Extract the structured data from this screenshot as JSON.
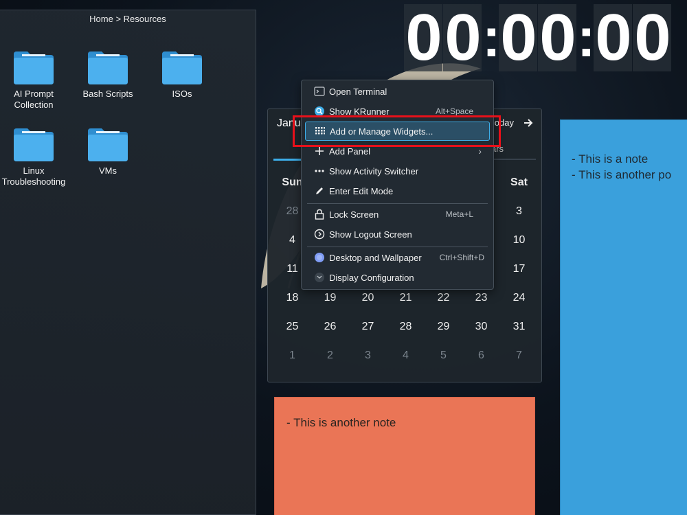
{
  "folder_view": {
    "breadcrumb": "Home > Resources",
    "items": [
      {
        "label_1": "AI Prompt",
        "label_2": "Collection"
      },
      {
        "label_1": "Bash Scripts",
        "label_2": ""
      },
      {
        "label_1": "ISOs",
        "label_2": ""
      },
      {
        "label_1": "Linux",
        "label_2": "Troubleshooting"
      },
      {
        "label_1": "VMs",
        "label_2": ""
      }
    ]
  },
  "clock": {
    "digits": [
      "0",
      "0",
      "0",
      "0",
      "0",
      "0"
    ],
    "separator": ":"
  },
  "calendar": {
    "month_partial": "Janua",
    "today_label": "oday",
    "next_icon": "arrow-right-icon",
    "tab_label_partial": "ars",
    "weekdays": [
      "Sun",
      "",
      "",
      "",
      "",
      "",
      "Sat"
    ],
    "weeks": [
      [
        "28",
        "",
        "",
        "",
        "",
        "",
        "3"
      ],
      [
        "4",
        "",
        "",
        "",
        "",
        "",
        "10"
      ],
      [
        "11",
        "",
        "",
        "",
        "",
        "",
        "17"
      ],
      [
        "18",
        "19",
        "20",
        "21",
        "22",
        "23",
        "24"
      ],
      [
        "25",
        "26",
        "27",
        "28",
        "29",
        "30",
        "31"
      ],
      [
        "1",
        "2",
        "3",
        "4",
        "5",
        "6",
        "7"
      ]
    ]
  },
  "notes": {
    "blue": [
      "- This is a note",
      "- This is another po"
    ],
    "orange": "- This is another note"
  },
  "context_menu": {
    "items": [
      {
        "label": "Open Terminal",
        "shortcut": "",
        "icon": "terminal-icon"
      },
      {
        "label": "Show KRunner",
        "shortcut": "Alt+Space",
        "icon": "search-icon"
      },
      {
        "label": "Add or Manage Widgets...",
        "shortcut": "",
        "icon": "grid-icon"
      },
      {
        "label": "Add Panel",
        "shortcut": "",
        "icon": "plus-icon"
      },
      {
        "label": "Show Activity Switcher",
        "shortcut": "",
        "icon": "dots-icon"
      },
      {
        "label": "Enter Edit Mode",
        "shortcut": "",
        "icon": "pencil-icon"
      },
      {
        "label": "Lock Screen",
        "shortcut": "Meta+L",
        "icon": "lock-icon"
      },
      {
        "label": "Show Logout Screen",
        "shortcut": "",
        "icon": "logout-icon"
      },
      {
        "label": "Desktop and Wallpaper",
        "shortcut": "Ctrl+Shift+D",
        "icon": "wallpaper-icon"
      },
      {
        "label": "Display Configuration",
        "shortcut": "",
        "icon": "display-icon"
      }
    ]
  },
  "colors": {
    "accent": "#3daee9",
    "highlight_border": "#e8101a",
    "note_blue": "#3aa0dc",
    "note_orange": "#ea7556",
    "folder": "#3fa7e6"
  }
}
